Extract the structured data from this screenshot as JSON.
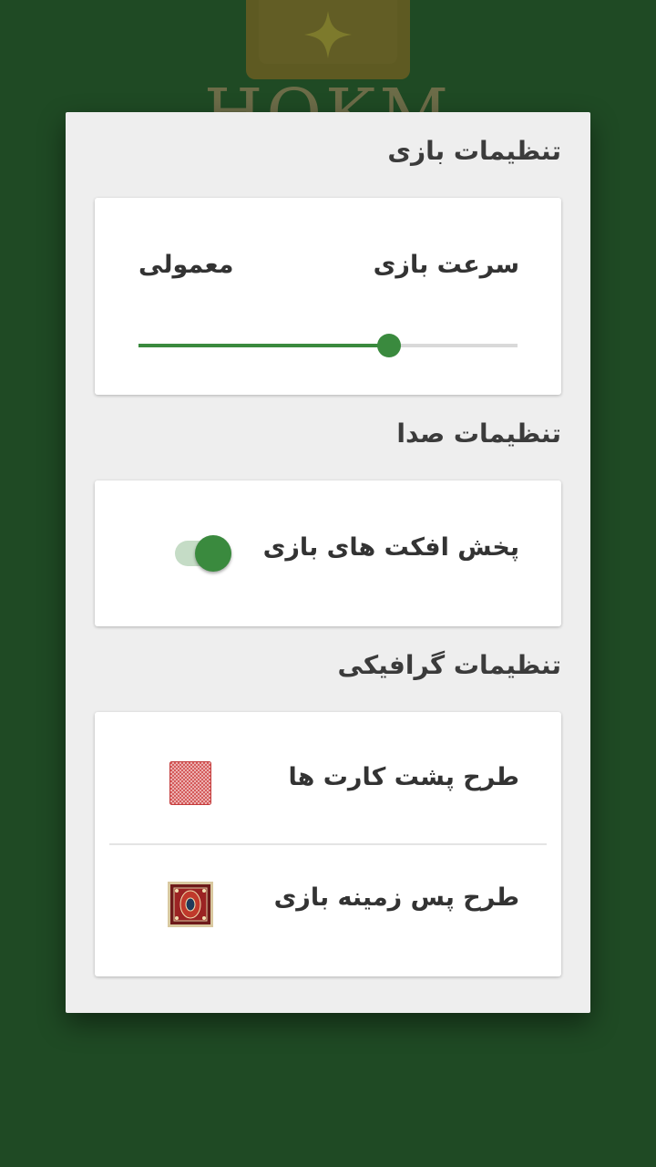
{
  "background": {
    "logo_text": "HOKM",
    "colors": {
      "background": "#1f4a24",
      "accent": "#3a8a3e"
    }
  },
  "dialog": {
    "game_settings": {
      "title": "تنظیمات بازی",
      "speed_label": "سرعت بازی",
      "speed_value": "معمولی",
      "speed_fraction": 0.66
    },
    "sound_settings": {
      "title": "تنظیمات صدا",
      "effects_label": "پخش افکت های بازی",
      "effects_enabled": true
    },
    "graphics_settings": {
      "title": "تنظیمات گرافیکی",
      "card_back_label": "طرح پشت کارت ها",
      "card_back_icon": "card-back-pattern-icon",
      "background_label": "طرح پس زمینه بازی",
      "background_icon": "persian-rug-icon"
    }
  }
}
